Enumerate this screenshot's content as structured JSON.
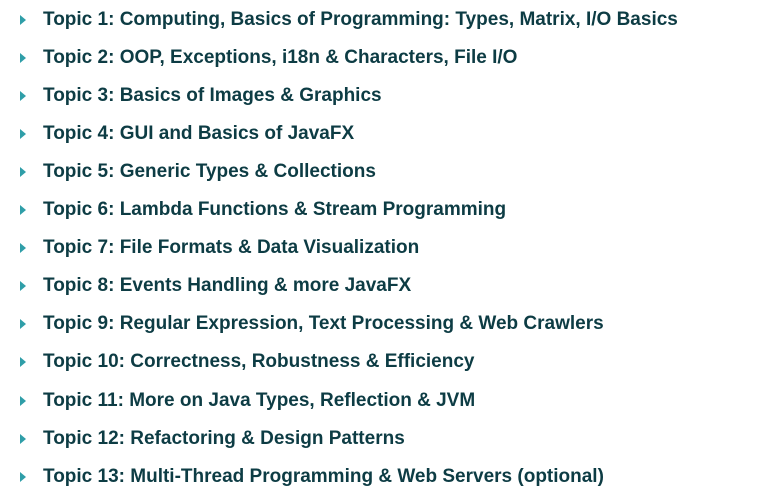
{
  "topics": [
    {
      "label": "Topic 1: Computing, Basics of Programming: Types, Matrix, I/O Basics"
    },
    {
      "label": "Topic 2: OOP, Exceptions, i18n & Characters, File I/O"
    },
    {
      "label": "Topic 3: Basics of Images & Graphics"
    },
    {
      "label": "Topic 4: GUI and Basics of JavaFX"
    },
    {
      "label": "Topic 5: Generic Types & Collections"
    },
    {
      "label": "Topic 6: Lambda Functions & Stream Programming"
    },
    {
      "label": "Topic 7: File Formats & Data Visualization"
    },
    {
      "label": "Topic 8: Events Handling & more JavaFX"
    },
    {
      "label": "Topic 9: Regular Expression, Text Processing & Web Crawlers"
    },
    {
      "label": "Topic 10: Correctness, Robustness & Efficiency"
    },
    {
      "label": "Topic 11: More on Java Types, Reflection & JVM"
    },
    {
      "label": "Topic 12: Refactoring & Design Patterns"
    },
    {
      "label": "Topic 13: Multi-Thread Programming & Web Servers (optional)"
    }
  ],
  "colors": {
    "text": "#0d3c44",
    "bullet": "#2f9ea8"
  }
}
